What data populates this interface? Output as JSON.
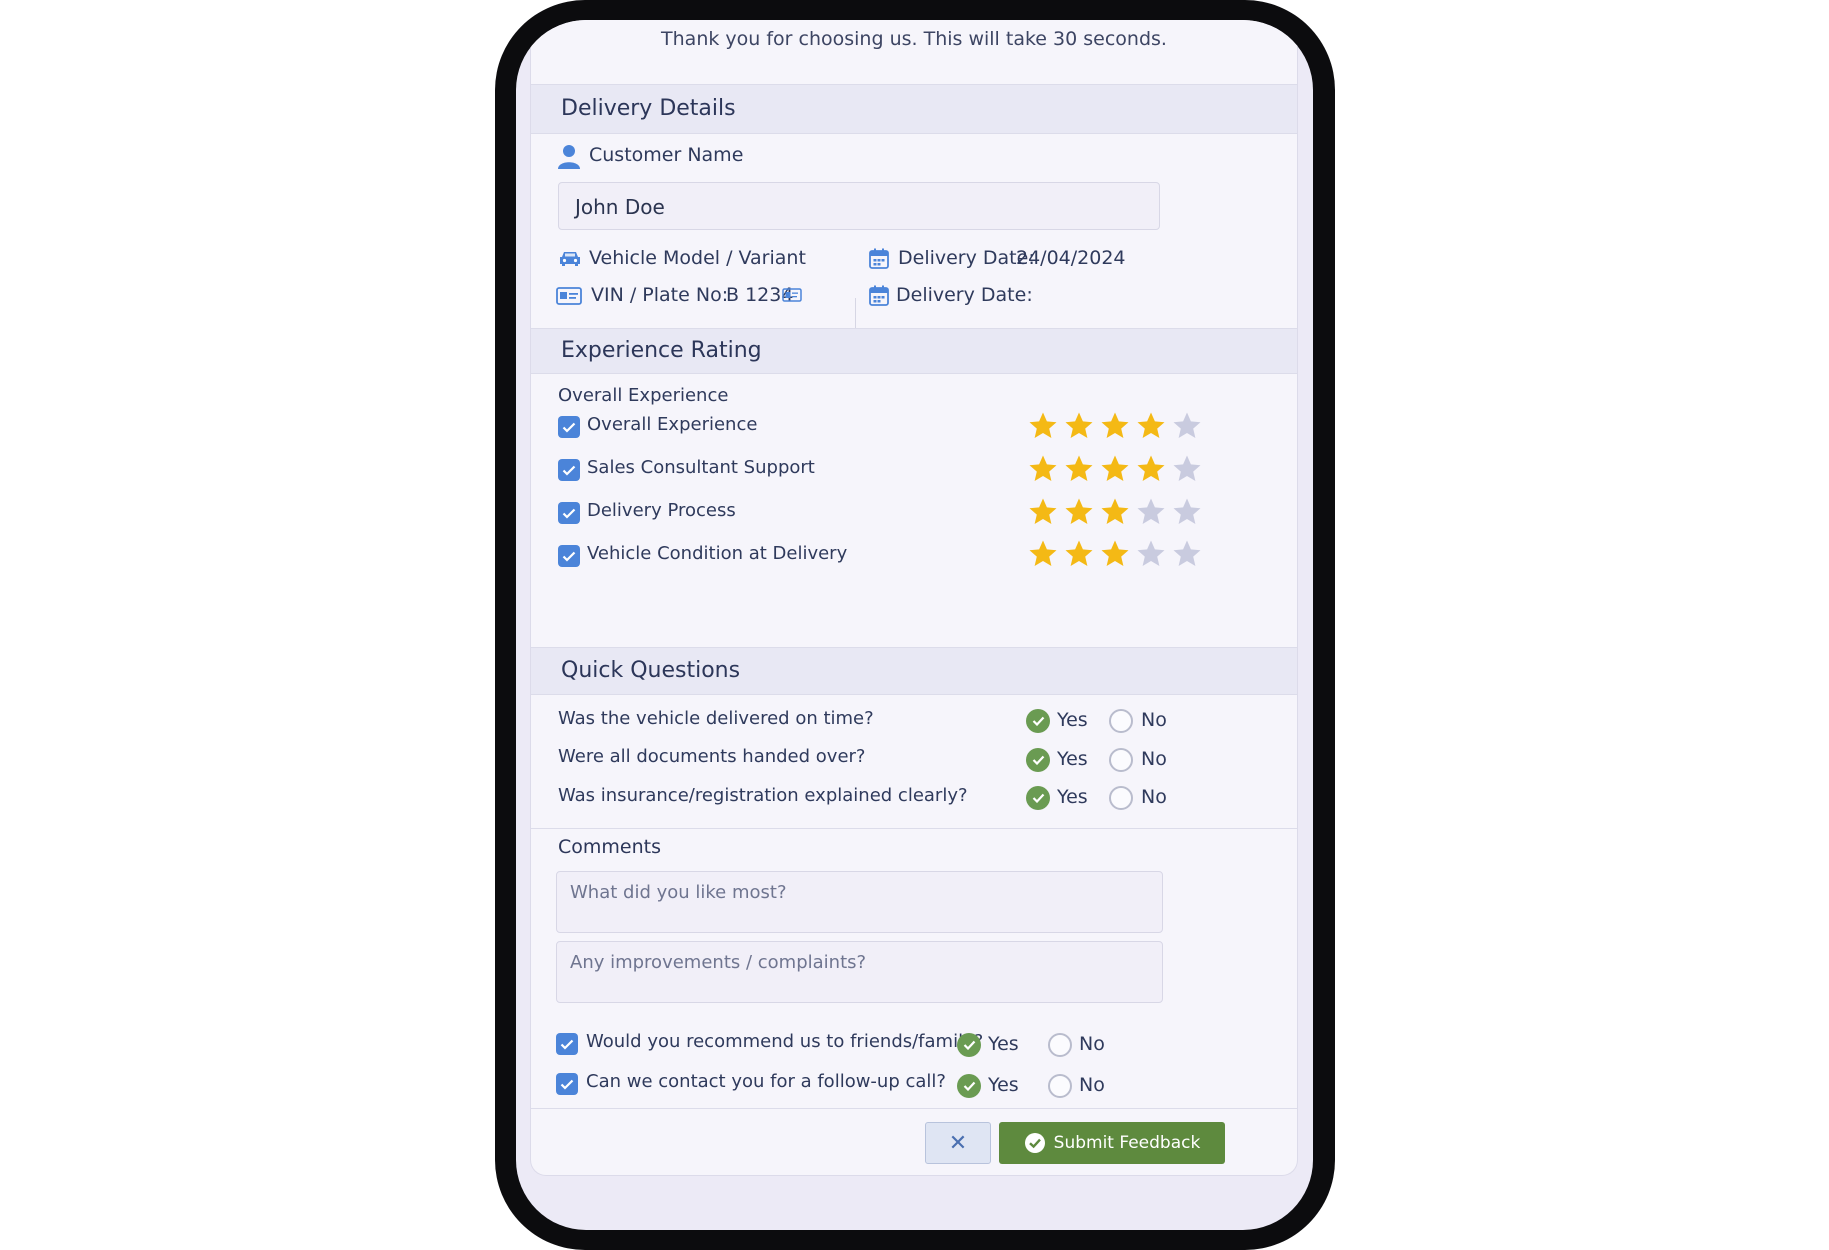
{
  "header": {
    "subtitle": "Thank you for choosing us. This will take 30 seconds."
  },
  "delivery": {
    "title": "Delivery Details",
    "customer_label": "Customer Name",
    "customer_value": "John Doe",
    "vehicle_label": "Vehicle Model / Variant",
    "vin_label": "VIN / Plate No:",
    "vin_value": "B 1234",
    "date_label": "Delivery Date:",
    "date_value": "24/04/2024",
    "date2_label": "Delivery Date:"
  },
  "rating": {
    "title": "Experience Rating",
    "overall_label": "Overall Experience",
    "items": [
      {
        "label": "Overall Experience",
        "checked": true,
        "stars": 4,
        "max": 5
      },
      {
        "label": "Sales Consultant Support",
        "checked": true,
        "stars": 4,
        "max": 5
      },
      {
        "label": "Delivery Process",
        "checked": true,
        "stars": 3,
        "max": 5
      },
      {
        "label": "Vehicle Condition at Delivery",
        "checked": true,
        "stars": 3,
        "max": 5
      }
    ]
  },
  "quick": {
    "title": "Quick Questions",
    "yes_label": "Yes",
    "no_label": "No",
    "questions": [
      {
        "text": "Was the vehicle delivered on time?",
        "answer": "Yes"
      },
      {
        "text": "Were all documents handed over?",
        "answer": "Yes"
      },
      {
        "text": "Was insurance/registration explained clearly?",
        "answer": "Yes"
      }
    ]
  },
  "comments": {
    "title": "Comments",
    "like_placeholder": "What did you like most?",
    "improve_placeholder": "Any improvements / complaints?",
    "followups": [
      {
        "text": "Would you recommend us to friends/family?",
        "checked": true,
        "answer": "Yes"
      },
      {
        "text": "Can we contact you for a follow-up call?",
        "checked": true,
        "answer": "Yes"
      }
    ]
  },
  "footer": {
    "cancel_label": "✕",
    "submit_label": "Submit Feedback"
  },
  "colors": {
    "star_on": "#f4b915",
    "star_off": "#c9cbdf",
    "check": "#4b84d9",
    "yes": "#6a9b52",
    "submit": "#5e8a3e"
  }
}
